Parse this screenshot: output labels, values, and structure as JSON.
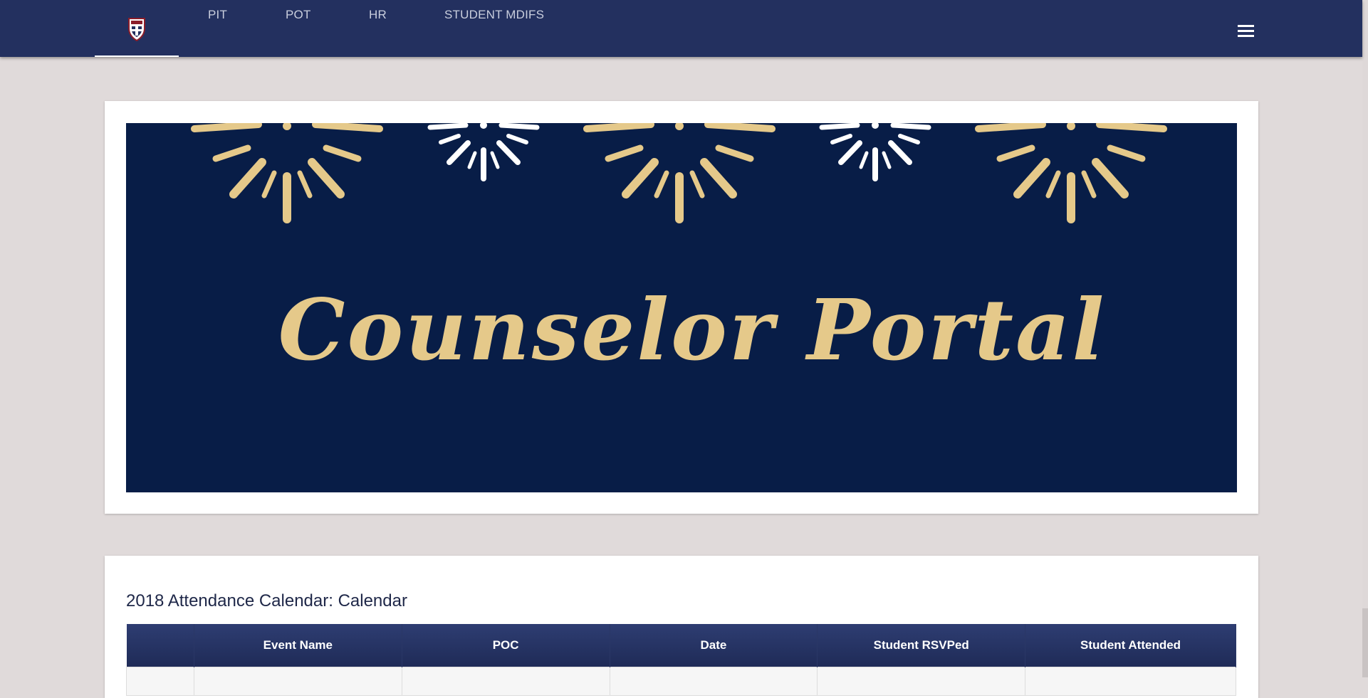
{
  "nav": {
    "logo_icon": "school-crest-icon",
    "items": [
      {
        "label": "PIT"
      },
      {
        "label": "POT"
      },
      {
        "label": "HR"
      },
      {
        "label": "STUDENT MDIFS"
      }
    ],
    "menu_icon": "hamburger-menu-icon"
  },
  "banner": {
    "text": "Counselor Portal",
    "colors": {
      "background": "#081d47",
      "gold": "#e5c98a",
      "white": "#ffffff"
    }
  },
  "calendar": {
    "title": "2018 Attendance Calendar: Calendar",
    "columns": [
      "",
      "Event Name",
      "POC",
      "Date",
      "Student RSVPed",
      "Student Attended"
    ]
  },
  "colors": {
    "navbar": "#23305f",
    "page_bg": "#e0dada",
    "table_header": "#24315f"
  }
}
